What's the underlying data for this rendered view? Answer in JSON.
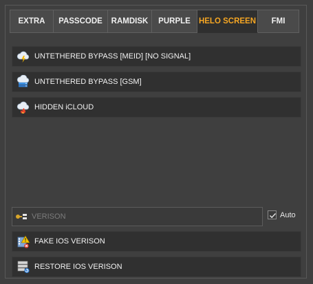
{
  "tabs": [
    {
      "label": "EXTRA",
      "active": false
    },
    {
      "label": "PASSCODE",
      "active": false
    },
    {
      "label": "RAMDISK",
      "active": false
    },
    {
      "label": "PURPLE",
      "active": false
    },
    {
      "label": "HELO SCREEN",
      "active": true
    },
    {
      "label": "FMI",
      "active": false
    }
  ],
  "actions": {
    "meid_bypass": "UNTETHERED BYPASS [MEID] [NO SIGNAL]",
    "gsm_bypass": "UNTETHERED BYPASS [GSM]",
    "hidden_icloud": "HIDDEN iCLOUD",
    "fake_ios_version": "FAKE IOS VERISON",
    "restore_ios_version": "RESTORE IOS VERISON"
  },
  "version_field": {
    "placeholder": "VERISON",
    "value": ""
  },
  "auto_checkbox": {
    "label": "Auto",
    "checked": true
  },
  "colors": {
    "accent": "#f5a623",
    "background": "#3f3f3f",
    "button": "#303030"
  }
}
